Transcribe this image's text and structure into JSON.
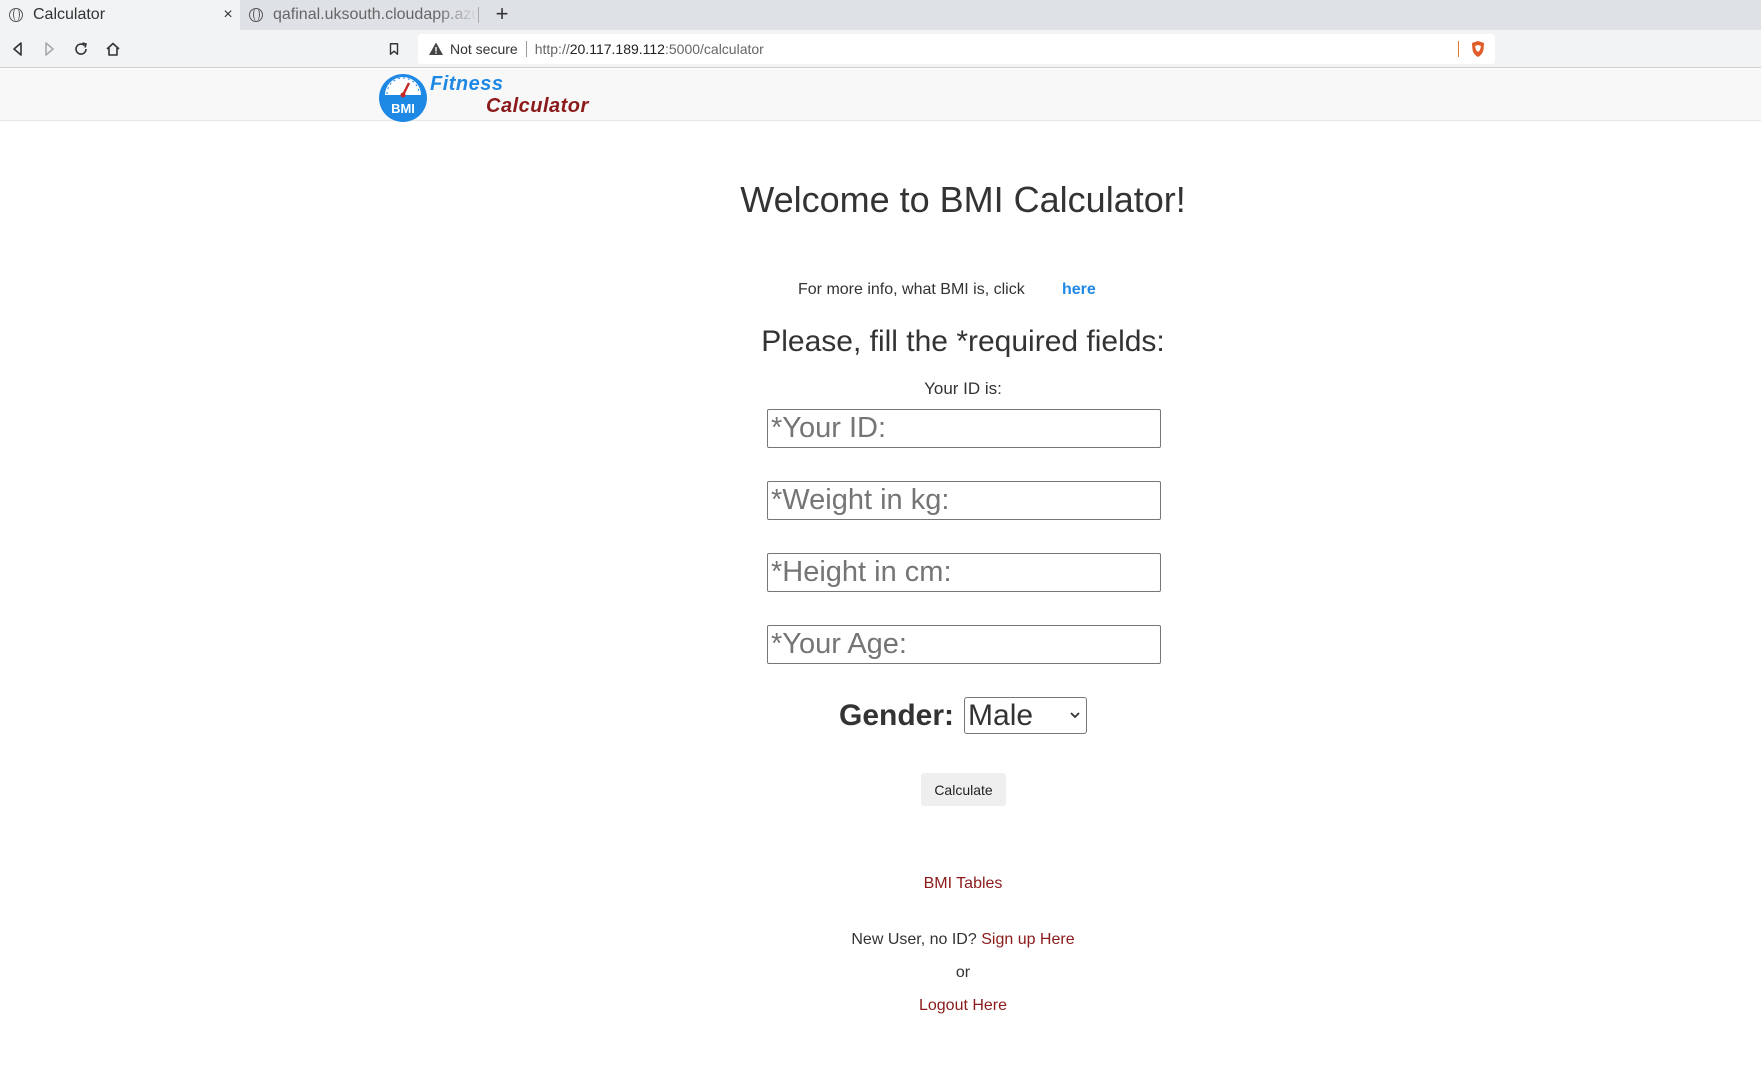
{
  "browser": {
    "tabs": [
      {
        "title": "Calculator",
        "active": true,
        "close": "×"
      },
      {
        "title": "qafinal.uksouth.cloudapp.azure.com",
        "active": false
      }
    ],
    "new_tab": "+",
    "security_label": "Not secure",
    "url_scheme": "http://",
    "url_host": "20.117.189.112",
    "url_path": ":5000/calculator"
  },
  "logo": {
    "badge": "BMI",
    "line1": "Fitness",
    "line2": "Calculator"
  },
  "page": {
    "heading": "Welcome to BMI Calculator!",
    "info_text": "For more info, what BMI is, click",
    "info_link": "here",
    "fill_title": "Please, fill the *required fields:",
    "id_label": "Your ID is:"
  },
  "form": {
    "id_placeholder": "*Your ID:",
    "weight_placeholder": "*Weight in kg:",
    "height_placeholder": "*Height in cm:",
    "age_placeholder": "*Your Age:",
    "gender_label": "Gender:",
    "gender_value": "Male",
    "submit_label": "Calculate"
  },
  "footer": {
    "bmi_tables": "BMI Tables",
    "new_user_text": "New User, no ID?",
    "signup_link": "Sign up Here",
    "or_text": "or",
    "logout_link": "Logout Here"
  },
  "colors": {
    "link_blue": "#1e88e5",
    "link_red": "#8b1a1a",
    "brave_orange": "#e05d2a"
  }
}
